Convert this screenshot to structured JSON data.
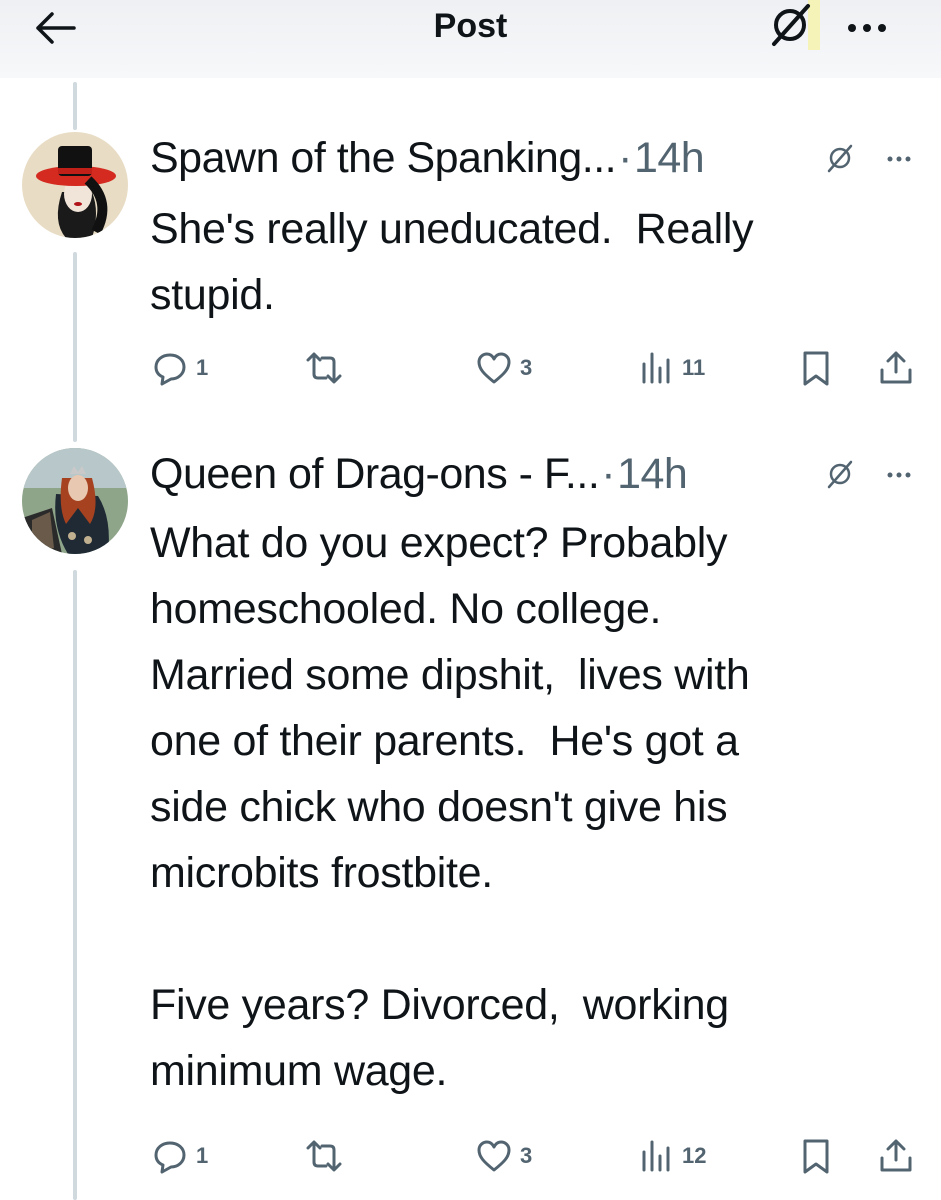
{
  "header": {
    "title": "Post",
    "back_icon": "arrow-left-icon",
    "grok_icon": "grok-icon",
    "more_icon": "more-horizontal-icon"
  },
  "posts": [
    {
      "author": "Spawn of the Spanking...",
      "separator": "·",
      "time": "14h",
      "text": "She's really uneducated.  Really\nstupid.",
      "replies": "1",
      "reposts": "",
      "likes": "3",
      "views": "11"
    },
    {
      "author": "Queen of Drag-ons - F...",
      "separator": "·",
      "time": "14h",
      "text": "What do you expect? Probably\nhomeschooled. No college.\nMarried some dipshit,  lives with\none of their parents.  He's got a\nside chick who doesn't give his\nmicrobits frostbite.\n\nFive years? Divorced,  working\nminimum wage.",
      "replies": "1",
      "reposts": "",
      "likes": "3",
      "views": "12"
    }
  ],
  "colors": {
    "text": "#0f1419",
    "secondary": "#536471",
    "thread_line": "#cfd9de"
  }
}
